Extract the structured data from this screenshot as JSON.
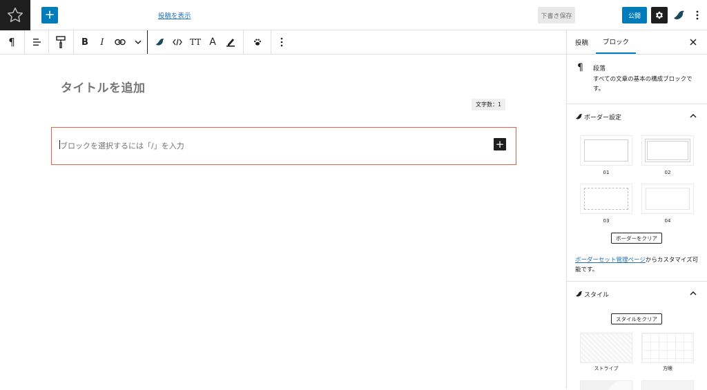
{
  "header": {
    "add_label": "+",
    "view_post": "投稿を表示",
    "save_draft": "下書き保存",
    "publish": "公開"
  },
  "toolbar": {
    "items": [
      "paragraph",
      "align",
      "block-style",
      "bold",
      "italic",
      "link",
      "more-rich-text",
      "snow-monkey",
      "code",
      "font-size",
      "text-color",
      "highlight",
      "paw",
      "options"
    ],
    "bold_label": "B",
    "italic_label": "I",
    "font_size_label": "TT",
    "color_label": "A"
  },
  "editor": {
    "title_placeholder": "タイトルを追加",
    "word_count": "文字数：1",
    "paragraph_placeholder": "ブロックを選択するには「/」を入力",
    "inserter_label": "+"
  },
  "sidebar": {
    "tabs": [
      {
        "label": "投稿",
        "active": false
      },
      {
        "label": "ブロック",
        "active": true
      }
    ],
    "block_card": {
      "icon": "¶",
      "title": "段落",
      "description": "すべての文章の基本の構成ブロックです。"
    },
    "border_panel": {
      "title": "ボーダー設定",
      "options": [
        "01",
        "02",
        "03",
        "04"
      ],
      "clear_label": "ボーダーをクリア",
      "note_link": "ボーダーセット管理ページ",
      "note_rest": "からカスタマイズ可能です。"
    },
    "style_panel": {
      "title": "スタイル",
      "clear_label": "スタイルをクリア",
      "options": [
        "ストライプ",
        "方眼"
      ]
    }
  },
  "colors": {
    "accent": "#007cba",
    "selection_border": "#e2624b",
    "dark": "#1e1e1e",
    "link": "#2271b1"
  }
}
